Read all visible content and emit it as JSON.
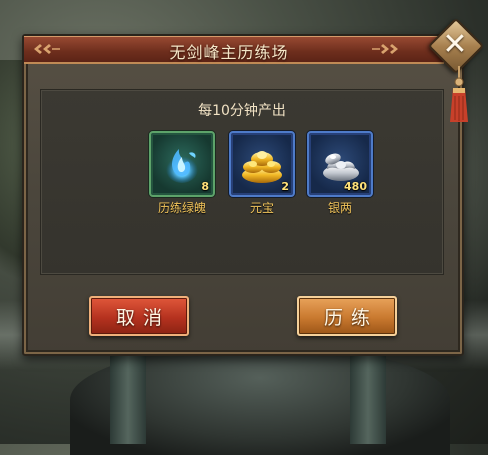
{
  "dialog": {
    "title": "无剑峰主历练场",
    "subtitle": "每10分钟产出"
  },
  "rewards": [
    {
      "name": "历练绿魄",
      "count": "8",
      "icon": "green-soul-flame-icon",
      "rarity_color": "#5da36a"
    },
    {
      "name": "元宝",
      "count": "2",
      "icon": "gold-ingot-icon",
      "rarity_color": "#4e7bc9"
    },
    {
      "name": "银两",
      "count": "480",
      "icon": "silver-ingot-icon",
      "rarity_color": "#4e7bc9"
    }
  ],
  "buttons": {
    "cancel_label": "取消",
    "train_label": "历练"
  },
  "close_icon": "close-icon",
  "colors": {
    "title_bar": "#6e2e1d",
    "item_name": "#f0c35a",
    "cancel_button": "#b5321f",
    "train_button": "#c9792f"
  }
}
